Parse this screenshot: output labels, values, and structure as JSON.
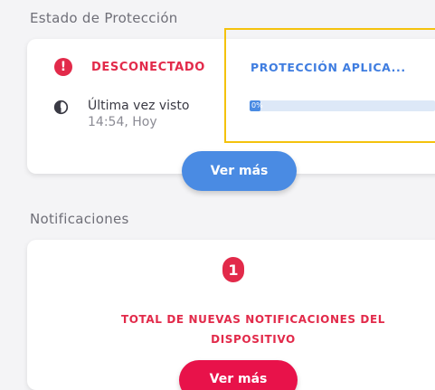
{
  "protection_section": {
    "title": "Estado de Protección",
    "status": "DESCONECTADO",
    "last_seen_label": "Última vez visto",
    "last_seen_time": "14:54, Hoy",
    "protection_title": "PROTECCIÓN APLICA...",
    "progress_text": "0%",
    "progress_fraction": 0.06,
    "button_label": "Ver más"
  },
  "notifications_section": {
    "title": "Notificaciones",
    "count": "1",
    "text": "TOTAL DE NUEVAS NOTIFICACIONES DEL DISPOSITIVO",
    "button_label": "Ver más"
  },
  "colors": {
    "alert_red": "#e22a4a",
    "accent_blue": "#4a8be3",
    "highlight_yellow": "#f4c20d"
  },
  "icons": {
    "status": "alert-icon",
    "last_seen": "clock-icon"
  }
}
